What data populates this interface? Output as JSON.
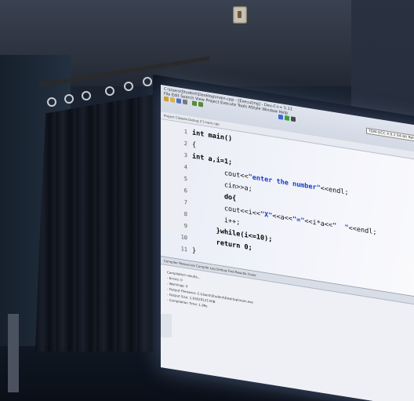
{
  "scene": {
    "description_hidden": "",
    "screen": {
      "menu_title": "C:\\Users\\Student\\Desktop\\main.cpp - [Executing] - Dev-C++ 5.11",
      "menu_items": "File  Edit  Search  View  Project  Execute  Tools  AStyle  Window  Help",
      "compiler": "TDM-GCC 4.9.2 64-bit Release",
      "tabs": "Project  Classes  Debug    [*] main.cpp",
      "code_lines": [
        {
          "n": "1",
          "text": "int main()"
        },
        {
          "n": "2",
          "text": "{"
        },
        {
          "n": "3",
          "text": "int a,i=1;"
        },
        {
          "n": "4",
          "text": "        cout<<\"enter the number\"<<endl;"
        },
        {
          "n": "5",
          "text": "        cin>>a;"
        },
        {
          "n": "6",
          "text": "        do{"
        },
        {
          "n": "7",
          "text": "        cout<<i<<\"X\"<<a<<\"=\"<<i*a<<\"  \"<<endl;"
        },
        {
          "n": "8",
          "text": "        i++;"
        },
        {
          "n": "9",
          "text": "      }while(i<=10);"
        },
        {
          "n": "10",
          "text": "      return 0;"
        },
        {
          "n": "11",
          "text": "}"
        }
      ],
      "bottom_tabs": "Compiler   Resources   Compile Log   Debug   Find Results   Close",
      "log_lines": [
        "Compilation results...",
        "- Errors: 0",
        "- Warnings: 0",
        "- Output Filename: C:\\Users\\Student\\Desktop\\main.exe",
        "- Output Size: 1.83028125 MiB",
        "- Compilation Time: 1.89s"
      ]
    }
  },
  "colors": {
    "screen": "#f4f5fb",
    "curtain": "#0c1018",
    "keyword": "#000000",
    "string": "#1a3cc8"
  }
}
